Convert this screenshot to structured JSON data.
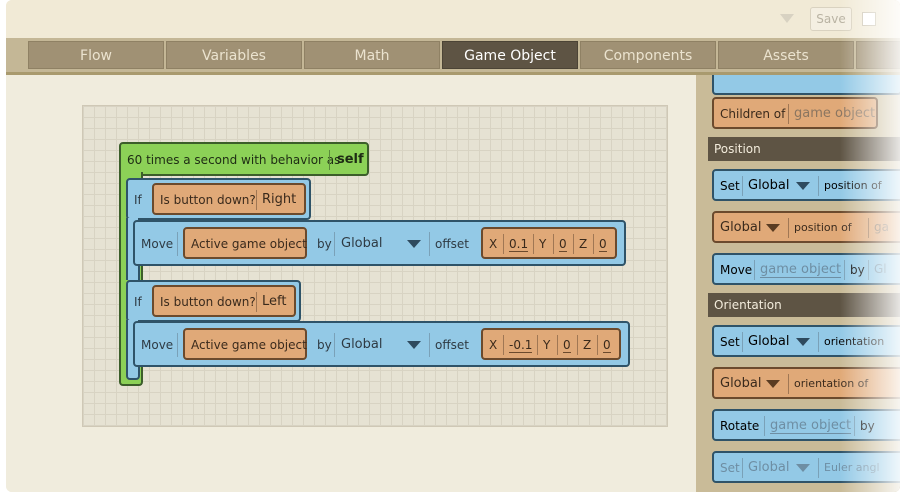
{
  "toolbar": {
    "save_label": "Save"
  },
  "tabs": [
    {
      "label": "Flow"
    },
    {
      "label": "Variables"
    },
    {
      "label": "Math"
    },
    {
      "label": "Game Object",
      "active": true
    },
    {
      "label": "Components"
    },
    {
      "label": "Assets"
    }
  ],
  "script": {
    "event": {
      "label": "60 times a second with behavior as",
      "target": "self"
    },
    "if1": {
      "if_label": "If",
      "condition": "Is button down?",
      "button": "Right"
    },
    "move1": {
      "move_label": "Move",
      "object": "Active game object",
      "by_label": "by",
      "space": "Global",
      "offset_label": "offset",
      "x_label": "X",
      "x": "0.1",
      "y_label": "Y",
      "y": "0",
      "z_label": "Z",
      "z": "0"
    },
    "if2": {
      "if_label": "If",
      "condition": "Is button down?",
      "button": "Left"
    },
    "move2": {
      "move_label": "Move",
      "object": "Active game object",
      "by_label": "by",
      "space": "Global",
      "offset_label": "offset",
      "x_label": "X",
      "x": "-0.1",
      "y_label": "Y",
      "y": "0",
      "z_label": "Z",
      "z": "0"
    }
  },
  "palette": {
    "children_label": "Children of",
    "children_arg": "game object",
    "position_header": "Position",
    "pos_set": {
      "set": "Set",
      "space": "Global",
      "rest": "position of"
    },
    "pos_get": {
      "space": "Global",
      "rest": "position of",
      "arg": "ga"
    },
    "pos_move": {
      "move": "Move",
      "arg": "game object",
      "by": "by",
      "tail": "Gl"
    },
    "orientation_header": "Orientation",
    "ori_set": {
      "set": "Set",
      "space": "Global",
      "rest": "orientation"
    },
    "ori_get": {
      "space": "Global",
      "rest": "orientation of"
    },
    "ori_rotate": {
      "rotate": "Rotate",
      "arg": "game object",
      "by": "by"
    },
    "euler_set": {
      "set": "Set",
      "space": "Global",
      "rest": "Euler angl"
    }
  },
  "colors": {
    "event_block": "#8cd157",
    "statement_block": "#93c9e6",
    "value_block": "#e0a978",
    "active_tab": "#5e5444",
    "tab": "#a09174"
  }
}
